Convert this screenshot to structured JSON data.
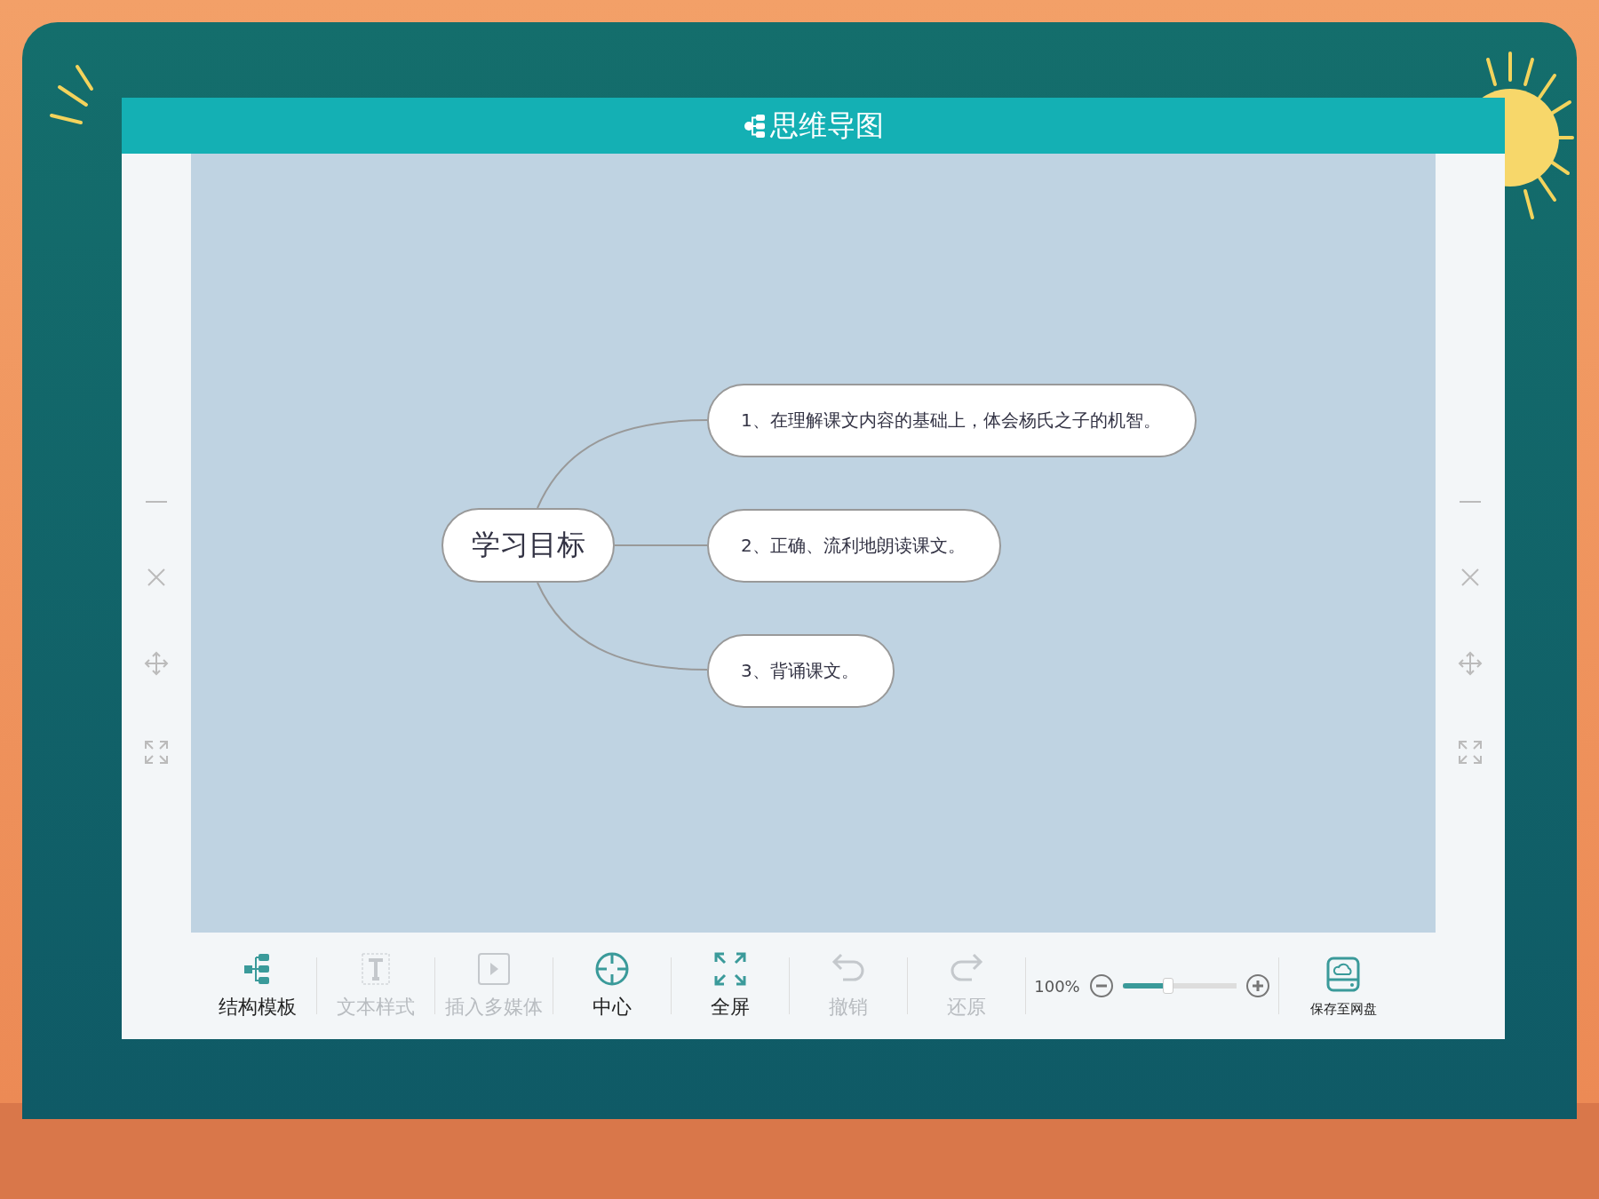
{
  "window": {
    "title": "思维导图"
  },
  "mind_map": {
    "root": "学习目标",
    "children": [
      {
        "label": "1、在理解课文内容的基础上，体会杨氏之子的机智。"
      },
      {
        "label": "2、正确、流利地朗读课文。"
      },
      {
        "label": "3、背诵课文。"
      }
    ]
  },
  "toolbar": [
    {
      "label": "结构模板",
      "disabled": false
    },
    {
      "label": "文本样式",
      "disabled": true
    },
    {
      "label": "插入多媒体",
      "disabled": true
    },
    {
      "label": "中心",
      "disabled": false
    },
    {
      "label": "全屏",
      "disabled": false
    },
    {
      "label": "撤销",
      "disabled": true
    },
    {
      "label": "还原",
      "disabled": true
    }
  ],
  "zoom": {
    "reading": "100%",
    "level": 0.4
  },
  "save": {
    "label": "保存至网盘"
  }
}
